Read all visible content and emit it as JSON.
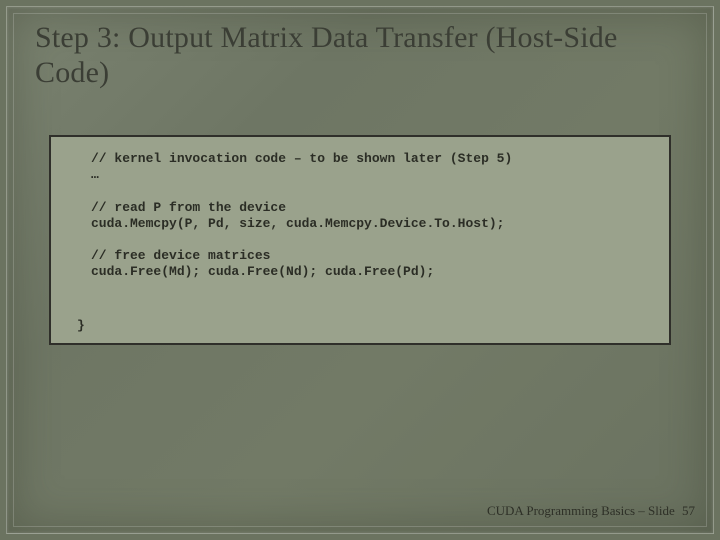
{
  "title": "Step 3: Output Matrix Data Transfer (Host-Side Code)",
  "code": {
    "l1": "// kernel invocation code – to be shown later (Step 5)",
    "l2": "…",
    "l3": "// read P from the device",
    "l4": "cuda.Memcpy(P, Pd, size, cuda.Memcpy.Device.To.Host);",
    "l5": "// free device matrices",
    "l6": "cuda.Free(Md); cuda.Free(Nd); cuda.Free(Pd);",
    "brace": "}"
  },
  "footer": {
    "label": "CUDA Programming Basics – Slide",
    "num": "57"
  }
}
